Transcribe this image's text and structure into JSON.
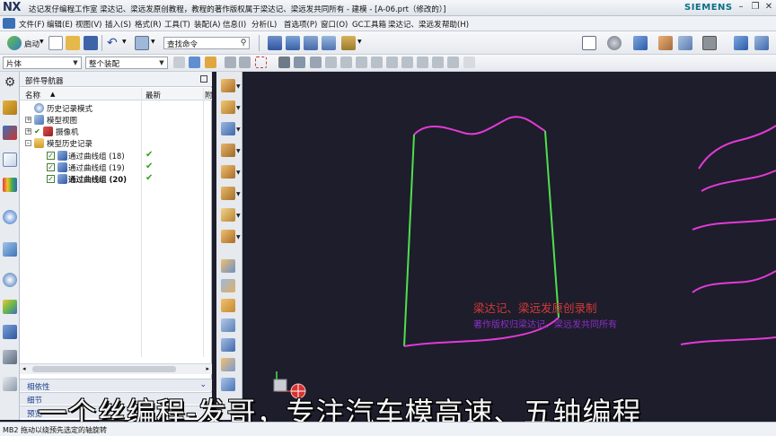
{
  "titlebar": {
    "logo": "NX",
    "title": "达记发仔编程工作室  梁达记、梁远发原创教程，教程的著作版权属于梁达记、梁远发共同所有 - 建模 - [A-06.prt（修改的）]",
    "brand": "SIEMENS",
    "buttons": [
      "–",
      "❐",
      "✕"
    ]
  },
  "menubar": {
    "items": [
      "文件(F)",
      "编辑(E)",
      "视图(V)",
      "插入(S)",
      "格式(R)",
      "工具(T)",
      "装配(A)",
      "信息(I)",
      "分析(L)",
      "首选项(P)",
      "窗口(O)",
      "GC工具箱",
      "梁达记、梁远发",
      "帮助(H)"
    ]
  },
  "toolbar": {
    "start_label": "启动",
    "search_placeholder": "查找命令",
    "selection_filter": "片体",
    "assembly_scope": "整个装配"
  },
  "navigator": {
    "title": "部件导航器",
    "col_name": "名称",
    "col_latest": "最新",
    "col_extra": "附",
    "rows": [
      {
        "label": "历史记录模式",
        "indent": 0,
        "bold": false,
        "latest": ""
      },
      {
        "label": "模型视图",
        "indent": 0,
        "bold": false,
        "latest": ""
      },
      {
        "label": "摄像机",
        "indent": 0,
        "bold": false,
        "latest": ""
      },
      {
        "label": "模型历史记录",
        "indent": 0,
        "bold": false,
        "latest": ""
      },
      {
        "label": "通过曲线组 (18)",
        "indent": 1,
        "bold": false,
        "latest": "✔"
      },
      {
        "label": "通过曲线组 (19)",
        "indent": 1,
        "bold": false,
        "latest": "✔"
      },
      {
        "label": "通过曲线组 (20)",
        "indent": 1,
        "bold": true,
        "latest": "✔"
      }
    ],
    "sections": [
      "相依性",
      "细节",
      "预览"
    ]
  },
  "graphics": {
    "watermark_line1": "梁达记、梁远发原创录制",
    "watermark_line2": "著作版权归梁达记、梁远发共同所有",
    "colors": {
      "background": "#1d1d2b",
      "curve_magenta": "#e33ad6",
      "edge_green": "#4fe04b"
    }
  },
  "caption": "一个丝编程-发哥，专注汽车模高速、五轴编程",
  "status": {
    "text": "MB2 拖动以绕预先选定的轴旋转"
  }
}
